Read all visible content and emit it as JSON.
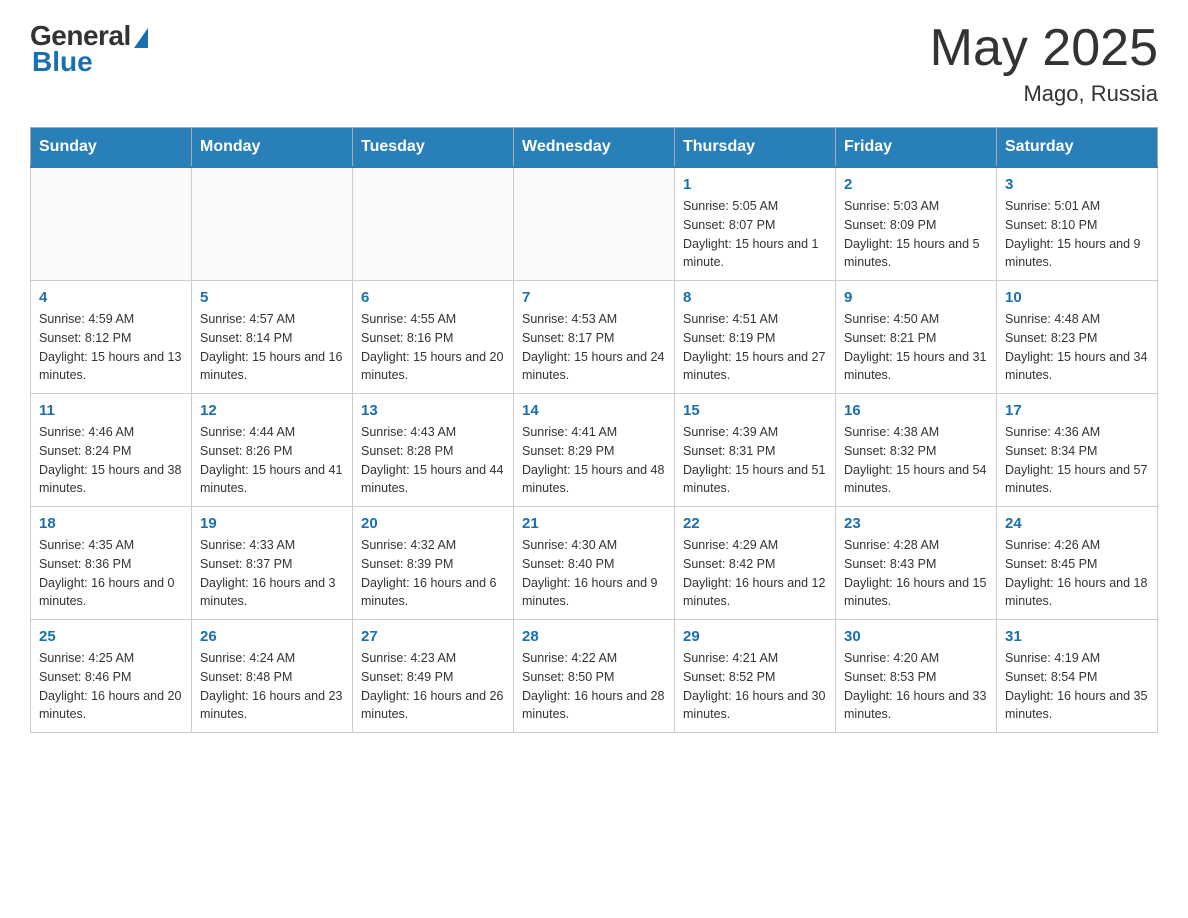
{
  "header": {
    "logo_general": "General",
    "logo_blue": "Blue",
    "month_title": "May 2025",
    "location": "Mago, Russia"
  },
  "days_of_week": [
    "Sunday",
    "Monday",
    "Tuesday",
    "Wednesday",
    "Thursday",
    "Friday",
    "Saturday"
  ],
  "weeks": [
    [
      {
        "day": "",
        "info": ""
      },
      {
        "day": "",
        "info": ""
      },
      {
        "day": "",
        "info": ""
      },
      {
        "day": "",
        "info": ""
      },
      {
        "day": "1",
        "info": "Sunrise: 5:05 AM\nSunset: 8:07 PM\nDaylight: 15 hours and 1 minute."
      },
      {
        "day": "2",
        "info": "Sunrise: 5:03 AM\nSunset: 8:09 PM\nDaylight: 15 hours and 5 minutes."
      },
      {
        "day": "3",
        "info": "Sunrise: 5:01 AM\nSunset: 8:10 PM\nDaylight: 15 hours and 9 minutes."
      }
    ],
    [
      {
        "day": "4",
        "info": "Sunrise: 4:59 AM\nSunset: 8:12 PM\nDaylight: 15 hours and 13 minutes."
      },
      {
        "day": "5",
        "info": "Sunrise: 4:57 AM\nSunset: 8:14 PM\nDaylight: 15 hours and 16 minutes."
      },
      {
        "day": "6",
        "info": "Sunrise: 4:55 AM\nSunset: 8:16 PM\nDaylight: 15 hours and 20 minutes."
      },
      {
        "day": "7",
        "info": "Sunrise: 4:53 AM\nSunset: 8:17 PM\nDaylight: 15 hours and 24 minutes."
      },
      {
        "day": "8",
        "info": "Sunrise: 4:51 AM\nSunset: 8:19 PM\nDaylight: 15 hours and 27 minutes."
      },
      {
        "day": "9",
        "info": "Sunrise: 4:50 AM\nSunset: 8:21 PM\nDaylight: 15 hours and 31 minutes."
      },
      {
        "day": "10",
        "info": "Sunrise: 4:48 AM\nSunset: 8:23 PM\nDaylight: 15 hours and 34 minutes."
      }
    ],
    [
      {
        "day": "11",
        "info": "Sunrise: 4:46 AM\nSunset: 8:24 PM\nDaylight: 15 hours and 38 minutes."
      },
      {
        "day": "12",
        "info": "Sunrise: 4:44 AM\nSunset: 8:26 PM\nDaylight: 15 hours and 41 minutes."
      },
      {
        "day": "13",
        "info": "Sunrise: 4:43 AM\nSunset: 8:28 PM\nDaylight: 15 hours and 44 minutes."
      },
      {
        "day": "14",
        "info": "Sunrise: 4:41 AM\nSunset: 8:29 PM\nDaylight: 15 hours and 48 minutes."
      },
      {
        "day": "15",
        "info": "Sunrise: 4:39 AM\nSunset: 8:31 PM\nDaylight: 15 hours and 51 minutes."
      },
      {
        "day": "16",
        "info": "Sunrise: 4:38 AM\nSunset: 8:32 PM\nDaylight: 15 hours and 54 minutes."
      },
      {
        "day": "17",
        "info": "Sunrise: 4:36 AM\nSunset: 8:34 PM\nDaylight: 15 hours and 57 minutes."
      }
    ],
    [
      {
        "day": "18",
        "info": "Sunrise: 4:35 AM\nSunset: 8:36 PM\nDaylight: 16 hours and 0 minutes."
      },
      {
        "day": "19",
        "info": "Sunrise: 4:33 AM\nSunset: 8:37 PM\nDaylight: 16 hours and 3 minutes."
      },
      {
        "day": "20",
        "info": "Sunrise: 4:32 AM\nSunset: 8:39 PM\nDaylight: 16 hours and 6 minutes."
      },
      {
        "day": "21",
        "info": "Sunrise: 4:30 AM\nSunset: 8:40 PM\nDaylight: 16 hours and 9 minutes."
      },
      {
        "day": "22",
        "info": "Sunrise: 4:29 AM\nSunset: 8:42 PM\nDaylight: 16 hours and 12 minutes."
      },
      {
        "day": "23",
        "info": "Sunrise: 4:28 AM\nSunset: 8:43 PM\nDaylight: 16 hours and 15 minutes."
      },
      {
        "day": "24",
        "info": "Sunrise: 4:26 AM\nSunset: 8:45 PM\nDaylight: 16 hours and 18 minutes."
      }
    ],
    [
      {
        "day": "25",
        "info": "Sunrise: 4:25 AM\nSunset: 8:46 PM\nDaylight: 16 hours and 20 minutes."
      },
      {
        "day": "26",
        "info": "Sunrise: 4:24 AM\nSunset: 8:48 PM\nDaylight: 16 hours and 23 minutes."
      },
      {
        "day": "27",
        "info": "Sunrise: 4:23 AM\nSunset: 8:49 PM\nDaylight: 16 hours and 26 minutes."
      },
      {
        "day": "28",
        "info": "Sunrise: 4:22 AM\nSunset: 8:50 PM\nDaylight: 16 hours and 28 minutes."
      },
      {
        "day": "29",
        "info": "Sunrise: 4:21 AM\nSunset: 8:52 PM\nDaylight: 16 hours and 30 minutes."
      },
      {
        "day": "30",
        "info": "Sunrise: 4:20 AM\nSunset: 8:53 PM\nDaylight: 16 hours and 33 minutes."
      },
      {
        "day": "31",
        "info": "Sunrise: 4:19 AM\nSunset: 8:54 PM\nDaylight: 16 hours and 35 minutes."
      }
    ]
  ]
}
